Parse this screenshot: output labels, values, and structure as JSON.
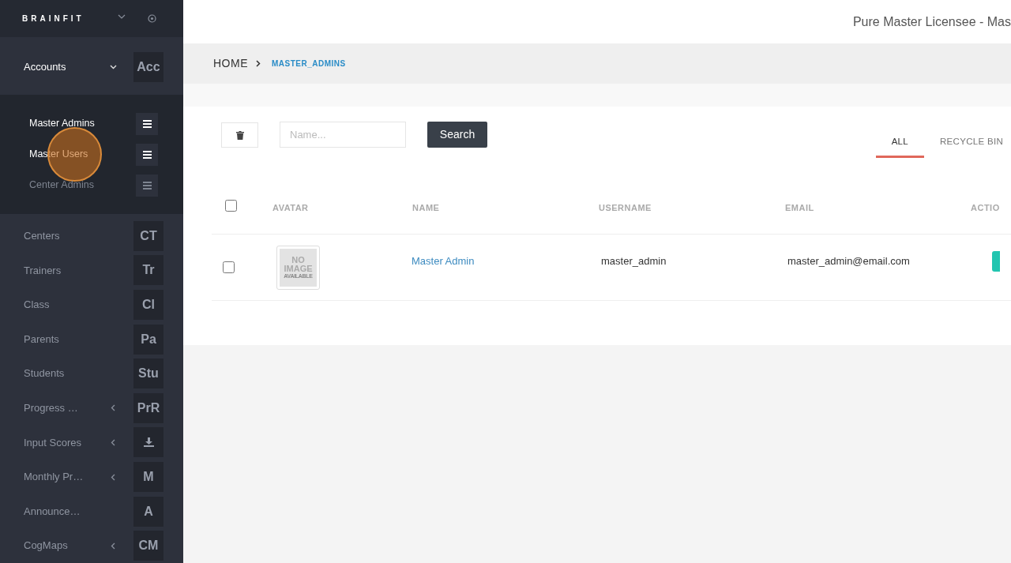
{
  "brand": "BRAINFIT",
  "sidebar": {
    "items": [
      {
        "label": "Accounts",
        "badge": "Acc",
        "kind": "text",
        "has_submenu": true,
        "expanded": true,
        "children": [
          {
            "label": "Master Admins",
            "disabled": false
          },
          {
            "label": "Master Users",
            "disabled": false
          },
          {
            "label": "Center Admins",
            "disabled": true
          }
        ]
      },
      {
        "label": "Centers",
        "badge": "CT",
        "kind": "text",
        "has_submenu": false
      },
      {
        "label": "Trainers",
        "badge": "Tr",
        "kind": "text",
        "has_submenu": false
      },
      {
        "label": "Class",
        "badge": "Cl",
        "kind": "text",
        "has_submenu": false
      },
      {
        "label": "Parents",
        "badge": "Pa",
        "kind": "text",
        "has_submenu": false
      },
      {
        "label": "Students",
        "badge": "Stu",
        "kind": "text",
        "has_submenu": false
      },
      {
        "label": "Progress …",
        "badge": "PrR",
        "kind": "text",
        "has_submenu": true,
        "expanded": false
      },
      {
        "label": "Input Scores",
        "kind": "download",
        "has_submenu": true,
        "expanded": false
      },
      {
        "label": "Monthly Pr…",
        "badge": "M",
        "kind": "text",
        "has_submenu": true,
        "expanded": false
      },
      {
        "label": "Announce…",
        "badge": "A",
        "kind": "text",
        "has_submenu": false
      },
      {
        "label": "CogMaps",
        "badge": "CM",
        "kind": "text",
        "has_submenu": true,
        "expanded": false
      }
    ]
  },
  "header": {
    "user": "Pure Master Licensee - Mas"
  },
  "breadcrumb": {
    "home": "HOME",
    "current": "MASTER_ADMINS"
  },
  "toolbar": {
    "search_placeholder": "Name...",
    "search_button": "Search"
  },
  "tabs": [
    {
      "label": "ALL",
      "selected": true
    },
    {
      "label": "RECYCLE BIN",
      "selected": false
    }
  ],
  "table": {
    "columns": [
      "AVATAR",
      "NAME",
      "USERNAME",
      "EMAIL",
      "ACTIO"
    ],
    "rows": [
      {
        "checked": false,
        "avatar_text": [
          "NO",
          "IMAGE",
          "AVAILABLE"
        ],
        "name": "Master Admin",
        "username": "master_admin",
        "email": "master_admin@email.com"
      }
    ]
  },
  "header_checked": false
}
